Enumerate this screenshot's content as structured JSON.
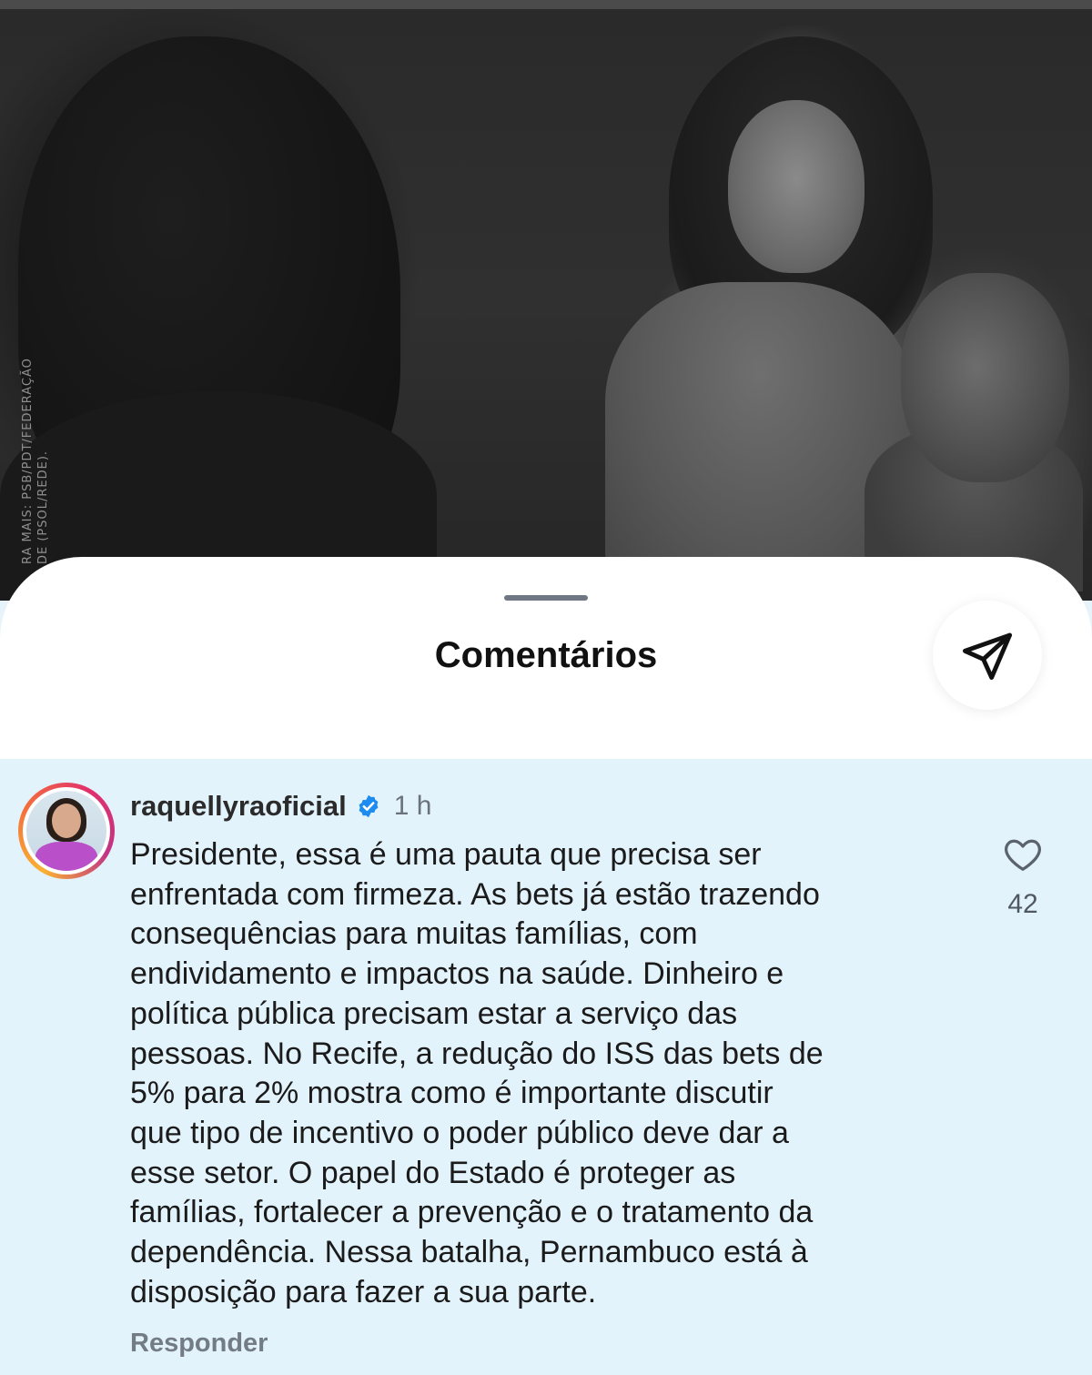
{
  "photo": {
    "credit_line1": "RA MAIS: PSB/PDT/FEDERAÇÃO",
    "credit_line2": "DE (PSOL/REDE)."
  },
  "sheet": {
    "title": "Comentários",
    "share_icon": "paper-plane-icon"
  },
  "comment": {
    "username": "raquellyraoficial",
    "verified_icon": "verified-badge-icon",
    "timestamp": "1 h",
    "text": "Presidente, essa é uma pauta que precisa ser\nenfrentada com firmeza. As bets já estão trazendo\nconsequências para muitas famílias, com\nendividamento e impactos na saúde. Dinheiro e\npolítica pública precisam estar a serviço das\npessoas. No Recife, a redução do ISS das bets de\n5% para 2% mostra como é importante discutir\nque tipo de incentivo o poder público deve dar a\nesse setor. O papel do Estado é proteger as\nfamílias, fortalecer a prevenção e o tratamento da\ndependência. Nessa batalha, Pernambuco está à\ndisposição para fazer a sua parte.",
    "reply_label": "Responder",
    "like_icon": "heart-icon",
    "like_count": "42"
  },
  "colors": {
    "comment_highlight": "#e3f3fc",
    "verified_blue": "#1d8cf0",
    "muted_text": "#737b84"
  }
}
